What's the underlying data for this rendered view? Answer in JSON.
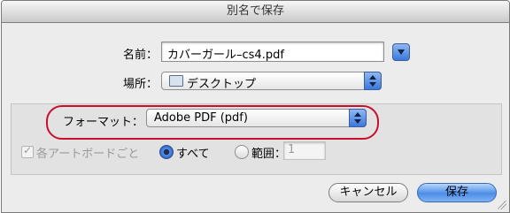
{
  "window": {
    "title": "別名で保存"
  },
  "name_row": {
    "label": "名前：",
    "value": "カバーガール–cs4.pdf"
  },
  "place_row": {
    "label": "場所：",
    "value": "デスクトップ"
  },
  "format_row": {
    "label": "フォーマット：",
    "value": "Adobe PDF (pdf)"
  },
  "options": {
    "each_artboard_label": "各アートボードごと",
    "all_label": "すべて",
    "range_label": "範囲：",
    "range_value": "1"
  },
  "buttons": {
    "cancel": "キャンセル",
    "save": "保存"
  }
}
